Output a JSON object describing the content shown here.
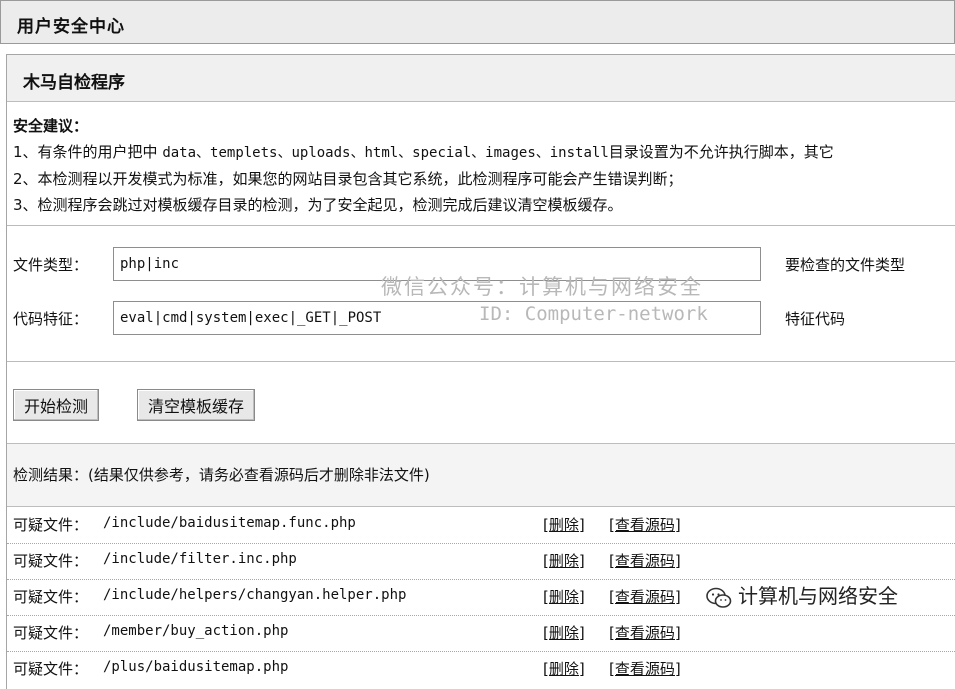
{
  "header": {
    "title": "用户安全中心"
  },
  "panel": {
    "title": "木马自检程序"
  },
  "advice": {
    "title": "安全建议：",
    "line1_prefix": "1、有条件的用户把中 ",
    "line1_dirs": "data、templets、uploads、html、special、images、install",
    "line1_suffix": "目录设置为不允许执行脚本，其它",
    "line2": "2、本检测程以开发模式为标准，如果您的网站目录包含其它系统，此检测程序可能会产生错误判断；",
    "line3": "3、检测程序会跳过对模板缓存目录的检测，为了安全起见，检测完成后建议清空模板缓存。"
  },
  "form": {
    "filetype_label": "文件类型：",
    "filetype_value": "php|inc",
    "filetype_hint": "要检查的文件类型",
    "code_label": "代码特征：",
    "code_value": "eval|cmd|system|exec|_GET|_POST",
    "code_hint": "特征代码"
  },
  "watermark": {
    "line1": "微信公众号：计算机与网络安全",
    "line2": "ID: Computer-network"
  },
  "buttons": {
    "start": "开始检测",
    "clear_cache": "清空模板缓存"
  },
  "results": {
    "header": "检测结果：(结果仅供参考，请务必查看源码后才删除非法文件)",
    "prefix": "可疑文件：",
    "delete_label": "[删除]",
    "view_label": "[查看源码]",
    "files": [
      "/include/baidusitemap.func.php",
      "/include/filter.inc.php",
      "/include/helpers/changyan.helper.php",
      "/member/buy_action.php",
      "/plus/baidusitemap.php"
    ]
  },
  "brand": {
    "text": "计算机与网络安全",
    "icon": "wechat-icon"
  }
}
